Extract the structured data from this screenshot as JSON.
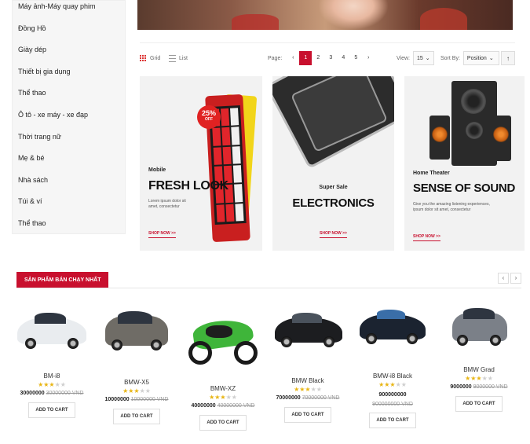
{
  "sidebar": {
    "items": [
      "Máy ảnh-Máy quay phim",
      "Đồng Hồ",
      "Giày dép",
      "Thiết bị gia dụng",
      "Thể thao",
      "Ô tô - xe máy - xe đạp",
      "Thời trang nữ",
      "Mẹ & bé",
      "Nhà sách",
      "Túi & ví",
      "Thể thao"
    ]
  },
  "toolbar": {
    "grid_label": "Grid",
    "list_label": "List",
    "page_label": "Page:",
    "prev": "‹",
    "next": "›",
    "pages": [
      "1",
      "2",
      "3",
      "4",
      "5"
    ],
    "active_page": "1",
    "view_label": "View:",
    "view_value": "15",
    "sort_label": "Sort By:",
    "sort_value": "Position",
    "sort_dir": "↑"
  },
  "promos": {
    "mobile": {
      "small": "Mobile",
      "title": "FRESH LOOK",
      "desc": "Lorem ipsum dolor sit amet, consectetur",
      "badge_pct": "25%",
      "badge_off": "OFF",
      "shop": "SHOP NOW >>"
    },
    "electronics": {
      "small": "Super Sale",
      "title": "ELECTRONICS",
      "shop": "SHOP NOW >>"
    },
    "sound": {
      "small": "Home Theater",
      "title": "SENSE OF SOUND",
      "desc": "Give you the amazing listening experiences, ipsum dolor sit amet, consectetur",
      "shop": "SHOP NOW >>"
    }
  },
  "section": {
    "title": "SẢN PHẨM BÁN CHẠY NHẤT",
    "prev": "‹",
    "next": "›"
  },
  "products": [
    {
      "name": "BM-i8",
      "stars": 3,
      "price": "30000000",
      "old_price": "30000000 VND",
      "cart": "ADD TO CART"
    },
    {
      "name": "BMW-X5",
      "stars": 3,
      "price": "10000000",
      "old_price": "10000000 VND",
      "cart": "ADD TO CART"
    },
    {
      "name": "BMW-XZ",
      "stars": 3,
      "price": "40000000",
      "old_price": "40000000 VND",
      "cart": "ADD TO CART"
    },
    {
      "name": "BMW Black",
      "stars": 3,
      "price": "70000000",
      "old_price": "70000000 VND",
      "cart": "ADD TO CART"
    },
    {
      "name": "BMW-i8 Black",
      "stars": 3,
      "price": "900000000",
      "old_price": "900000000 VND",
      "cart": "ADD TO CART"
    },
    {
      "name": "BMW Grad",
      "stars": 3,
      "price": "9000000",
      "old_price": "9000000 VND",
      "cart": "ADD TO CART"
    }
  ],
  "colors": {
    "accent": "#c8102e",
    "star": "#e8b513"
  }
}
